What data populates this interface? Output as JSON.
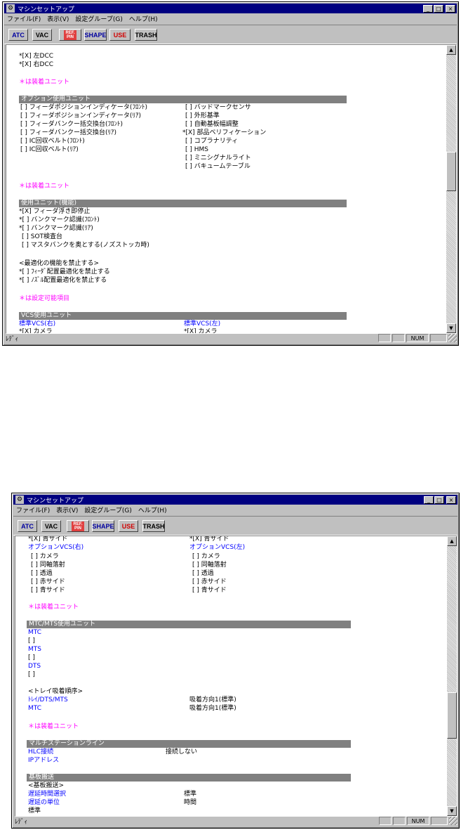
{
  "window": {
    "title": "マシンセットアップ",
    "menu": [
      "ファイル(F)",
      "表示(V)",
      "設定グループ(G)",
      "ヘルプ(H)"
    ],
    "controls": {
      "min": "_",
      "max": "□",
      "close": "×"
    }
  },
  "toolbar": {
    "atc": "ATC",
    "vac": "VAC",
    "refpin_top": "REF.",
    "refpin_bottom": "PIN",
    "shape": "SHAPE",
    "use": "USE",
    "trash": "TRASH"
  },
  "status": {
    "text": "ﾚﾃﾞｨ",
    "num": "NUM"
  },
  "screen1": {
    "dcc_left": "*[X] 左DCC",
    "dcc_right": "*[X] 右DCC",
    "note1": "＊は装着ユニット",
    "opt_header": "オプション使用ユニット",
    "opt_left": [
      "[ ] フィーダポジションインディケータ(ﾌﾛﾝﾄ)",
      "[ ] フィーダポジションインディケータ(ﾘｱ)",
      "[ ] フィーダバンクー括交換台(ﾌﾛﾝﾄ)",
      "[ ] フィーダバンクー括交換台(ﾘｱ)",
      "[ ] IC回収ベルト(ﾌﾛﾝﾄ)",
      "[ ] IC回収ベルト(ﾘｱ)"
    ],
    "opt_right": [
      "[ ] バッドマークセンサ",
      "[ ] 外形基準",
      "[ ] 自動基板幅調整",
      "*[X] 部品ベリフィケーション",
      "[ ] コプラナリティ",
      "[ ] HMS",
      "[ ] ミニシグナルライト",
      "[ ] バキュームテーブル"
    ],
    "note2": "＊は装着ユニット",
    "func_header": "使用ユニット(機能)",
    "func_items": [
      "*[X] フィーダ浮き即停止",
      "*[ ] バンクマーク認識(ﾌﾛﾝﾄ)",
      "*[ ] バンクマーク認識(ﾘｱ)",
      "[ ] SOT検査台",
      "[ ] マスタバンクを奥とする(ノズストッカ時)"
    ],
    "opt_title": "<最適化の機能を禁止する>",
    "opt_items": [
      "*[ ] ﾌｨｰﾀﾞ配置最適化を禁止する",
      "*[ ] ﾉｽﾞﾙ配置最適化を禁止する"
    ],
    "note3": "＊は設定可能項目",
    "vcs_header": "VCS使用ユニット",
    "vcs_left": "標準VCS(右)",
    "vcs_right": "標準VCS(左)",
    "vcs_left_cut": "*[X] カメラ",
    "vcs_right_cut": "*[X] カメラ"
  },
  "screen2": {
    "top_left": "*[X] 青サイド",
    "top_right": "*[X] 青サイド",
    "optvcs_left": "オプションVCS(右)",
    "optvcs_right": "オプションVCS(左)",
    "optvcs_items": [
      "[ ] カメラ",
      "[ ] 同軸落射",
      "[ ] 透過",
      "[ ] 赤サイド",
      "[ ] 青サイド"
    ],
    "note1": "＊は装着ユニット",
    "mtc_header": "MTC/MTS使用ユニット",
    "mtc": "MTC",
    "mtc_box": "[ ]",
    "mts": "MTS",
    "mts_box": "[ ]",
    "dts": "DTS",
    "dts_box": "[ ]",
    "tray_title": "<トレイ吸着順序>",
    "tray_rows": [
      {
        "label": "ﾄﾚｲ/DTS/MTS",
        "value": "吸着方向1(標準)"
      },
      {
        "label": "MTC",
        "value": "吸着方向1(標準)"
      }
    ],
    "note2": "＊は装着ユニット",
    "msl_header": "マルチステーションライン",
    "hlc_label": "HLC接続",
    "hlc_value": "接続しない",
    "ip_label": "IPアドレス",
    "basic_header": "基板搬送",
    "basic_title": "<基板搬送>",
    "delay_label": "遅延時間選択",
    "delay_value": "標準",
    "unit_label": "遅延の単位",
    "unit_value": "時間",
    "cut_text": "標準"
  }
}
